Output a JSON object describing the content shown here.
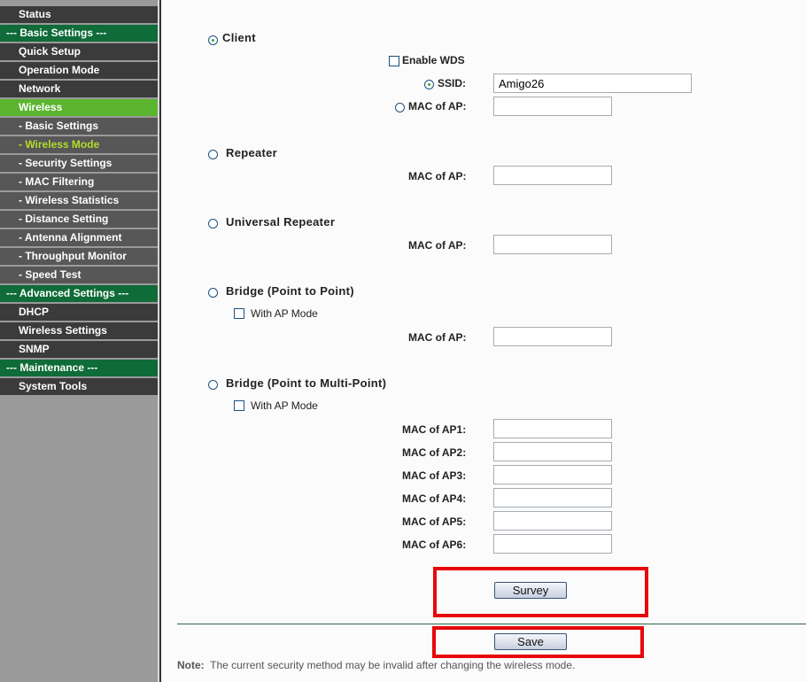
{
  "sidebar": {
    "items": [
      {
        "label": "Status",
        "type": "item"
      },
      {
        "label": "--- Basic Settings ---",
        "type": "section"
      },
      {
        "label": "Quick Setup",
        "type": "item"
      },
      {
        "label": "Operation Mode",
        "type": "item"
      },
      {
        "label": "Network",
        "type": "item"
      },
      {
        "label": "Wireless",
        "type": "active"
      },
      {
        "label": "- Basic Settings",
        "type": "sub"
      },
      {
        "label": "- Wireless Mode",
        "type": "current"
      },
      {
        "label": "- Security Settings",
        "type": "sub"
      },
      {
        "label": "- MAC Filtering",
        "type": "sub"
      },
      {
        "label": "- Wireless Statistics",
        "type": "sub"
      },
      {
        "label": "- Distance Setting",
        "type": "sub"
      },
      {
        "label": "- Antenna Alignment",
        "type": "sub"
      },
      {
        "label": "- Throughput Monitor",
        "type": "sub"
      },
      {
        "label": "- Speed Test",
        "type": "sub"
      },
      {
        "label": "--- Advanced Settings ---",
        "type": "section"
      },
      {
        "label": "DHCP",
        "type": "item"
      },
      {
        "label": "Wireless Settings",
        "type": "item"
      },
      {
        "label": "SNMP",
        "type": "item"
      },
      {
        "label": "--- Maintenance ---",
        "type": "section"
      },
      {
        "label": "System Tools",
        "type": "item"
      }
    ]
  },
  "client": {
    "label": "Client",
    "enable_wds": "Enable WDS",
    "ssid_label": "SSID:",
    "ssid_value": "Amigo26",
    "mac_label": "MAC of AP:",
    "mac_value": ""
  },
  "repeater": {
    "label": "Repeater",
    "mac_label": "MAC of AP:"
  },
  "universal": {
    "label": "Universal Repeater",
    "mac_label": "MAC of AP:"
  },
  "ptp": {
    "label": "Bridge (Point to Point)",
    "ap_mode": "With AP Mode",
    "mac_label": "MAC of AP:"
  },
  "ptmp": {
    "label": "Bridge (Point to Multi-Point)",
    "ap_mode": "With AP Mode",
    "macs": [
      "MAC of AP1:",
      "MAC of AP2:",
      "MAC of AP3:",
      "MAC of AP4:",
      "MAC of AP5:",
      "MAC of AP6:"
    ]
  },
  "buttons": {
    "survey": "Survey",
    "save": "Save"
  },
  "note": {
    "label": "Note:",
    "text": "The current security method may be invalid after changing the wireless mode."
  }
}
